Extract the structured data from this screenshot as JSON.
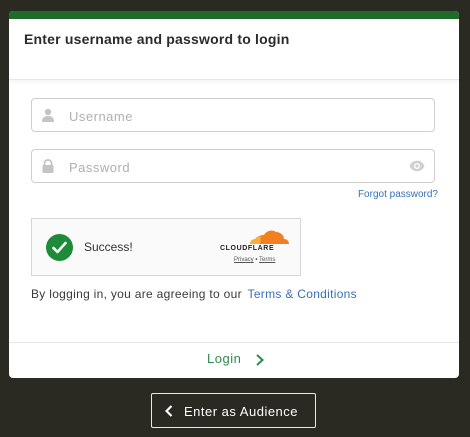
{
  "dialog": {
    "title": "Enter username and password to login",
    "accent_color": "#1f6b2a"
  },
  "form": {
    "username": {
      "placeholder": "Username",
      "value": "",
      "icon": "user-icon"
    },
    "password": {
      "placeholder": "Password",
      "value": "",
      "icon": "lock-icon",
      "toggle_icon": "eye-icon"
    },
    "forgot_label": "Forgot password?"
  },
  "captcha": {
    "status": "Success!",
    "brand": "CLOUDFLARE",
    "privacy_label": "Privacy",
    "separator": "•",
    "terms_label": "Terms",
    "status_color": "#1f8a3a"
  },
  "agreement": {
    "text": "By logging in, you are agreeing to our",
    "link_label": "Terms & Conditions"
  },
  "footer": {
    "login_label": "Login"
  },
  "audience": {
    "label": "Enter as Audience"
  }
}
